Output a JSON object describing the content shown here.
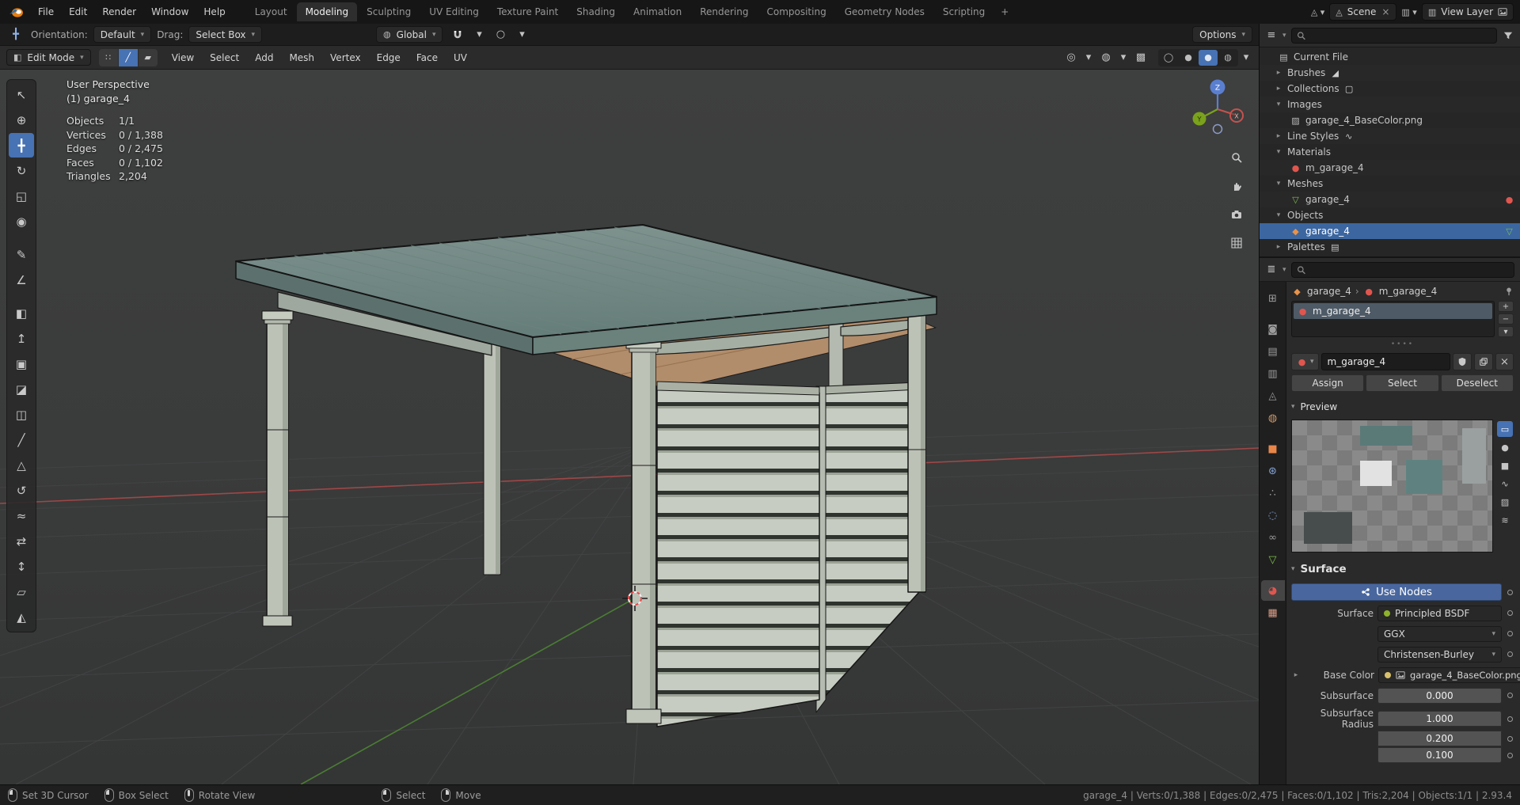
{
  "colors": {
    "accent_blue": "#4772b3",
    "object_orange": "#e87d0d",
    "mesh_green": "#7ec24a",
    "material_red": "#e0564f",
    "axis_x_red": "#b04a4a",
    "axis_y_green": "#4e8a33",
    "axis_z_blue": "#5a7fd0"
  },
  "topbar": {
    "menus": [
      "File",
      "Edit",
      "Render",
      "Window",
      "Help"
    ],
    "workspaces": [
      "Layout",
      "Modeling",
      "Sculpting",
      "UV Editing",
      "Texture Paint",
      "Shading",
      "Animation",
      "Rendering",
      "Compositing",
      "Geometry Nodes",
      "Scripting"
    ],
    "active_workspace": "Modeling",
    "add_tab": "+",
    "scene": {
      "label": "Scene"
    },
    "view_layer": {
      "label": "View Layer"
    }
  },
  "tool_settings": {
    "orientation_label": "Orientation:",
    "orientation_value": "Default",
    "drag_label": "Drag:",
    "drag_value": "Select Box",
    "transform_space": "Global",
    "options": "Options"
  },
  "viewport_header": {
    "mode": "Edit Mode",
    "menus": [
      "View",
      "Select",
      "Add",
      "Mesh",
      "Vertex",
      "Edge",
      "Face",
      "UV"
    ]
  },
  "toolbar_tools": [
    "select-box",
    "cursor",
    "move",
    "rotate",
    "scale",
    "transform",
    "annotate",
    "measure",
    "add-cube",
    "extrude-region",
    "inset-faces",
    "bevel",
    "loop-cut",
    "knife",
    "poly-build",
    "spin",
    "smooth",
    "edge-slide",
    "shrink-fatten",
    "shear",
    "rip-region"
  ],
  "active_tool": "move",
  "viewport": {
    "perspective_label": "User Perspective",
    "object_label": "(1) garage_4",
    "stats": [
      {
        "label": "Objects",
        "value": "1/1"
      },
      {
        "label": "Vertices",
        "value": "0 / 1,388"
      },
      {
        "label": "Edges",
        "value": "0 / 2,475"
      },
      {
        "label": "Faces",
        "value": "0 / 1,102"
      },
      {
        "label": "Triangles",
        "value": "2,204"
      }
    ],
    "gizmo": {
      "x": "X",
      "y": "Y",
      "z": "Z"
    }
  },
  "outliner": {
    "rows": [
      {
        "label": "Current File",
        "level": 0,
        "icon": "blend-file"
      },
      {
        "label": "Brushes",
        "level": 1,
        "arrow": "▸",
        "trail_icon": "brush"
      },
      {
        "label": "Collections",
        "level": 1,
        "arrow": "▸",
        "trail_icon": "collection"
      },
      {
        "label": "Images",
        "level": 1,
        "arrow": "▾"
      },
      {
        "label": "garage_4_BaseColor.png",
        "level": 2,
        "icon": "image"
      },
      {
        "label": "Line Styles",
        "level": 1,
        "arrow": "▸",
        "trail_icon": "linestyle"
      },
      {
        "label": "Materials",
        "level": 1,
        "arrow": "▾"
      },
      {
        "label": "m_garage_4",
        "level": 2,
        "icon": "material"
      },
      {
        "label": "Meshes",
        "level": 1,
        "arrow": "▾"
      },
      {
        "label": "garage_4",
        "level": 2,
        "icon": "mesh",
        "trail_icon": "material"
      },
      {
        "label": "Objects",
        "level": 1,
        "arrow": "▾"
      },
      {
        "label": "garage_4",
        "level": 2,
        "icon": "object",
        "trail_icon": "mesh",
        "selected": true
      },
      {
        "label": "Palettes",
        "level": 1,
        "arrow": "▸"
      }
    ]
  },
  "property_tabs": [
    "tool",
    "render",
    "output",
    "view-layer",
    "scene",
    "world",
    "object",
    "modifiers",
    "particles",
    "physics",
    "constraints",
    "object-data",
    "material",
    "texture"
  ],
  "active_property_tab": "material",
  "properties": {
    "breadcrumb": {
      "object": "garage_4",
      "separator": "›",
      "material": "m_garage_4"
    },
    "slot_name": "m_garage_4",
    "material_name": "m_garage_4",
    "buttons": {
      "assign": "Assign",
      "select": "Select",
      "deselect": "Deselect"
    },
    "preview_panel": "Preview",
    "preview_types": [
      "flat",
      "sphere",
      "cube",
      "hair",
      "cloth",
      "fluid"
    ],
    "surface_panel": "Surface",
    "use_nodes": "Use Nodes",
    "fields": {
      "surface_label": "Surface",
      "surface_value": "Principled BSDF",
      "distribution": "GGX",
      "subsurface_method": "Christensen-Burley",
      "base_color_label": "Base Color",
      "base_color_value": "garage_4_BaseColor.png",
      "subsurface_label": "Subsurface",
      "subsurface_value": "0.000",
      "subsurface_radius_label": "Subsurface Radius",
      "radius_x": "1.000",
      "radius_y": "0.200",
      "radius_z": "0.100"
    }
  },
  "statusbar": {
    "hints": [
      {
        "button": "left",
        "label": "Set 3D Cursor"
      },
      {
        "button": "left-drag",
        "label": "Box Select"
      },
      {
        "button": "middle",
        "label": "Rotate View"
      },
      {
        "button": "left",
        "label": "Select"
      },
      {
        "button": "right",
        "label": "Move"
      }
    ],
    "info": "garage_4 | Verts:0/1,388 | Edges:0/2,475 | Faces:0/1,102 | Tris:2,204 | Objects:1/1 | 2.93.4"
  }
}
